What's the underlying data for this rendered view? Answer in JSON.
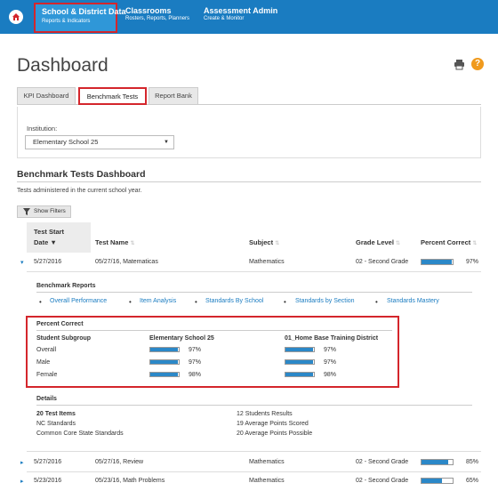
{
  "nav": {
    "active": {
      "title": "School & District Data",
      "sub": "Reports & Indicators"
    },
    "items": [
      {
        "title": "Classrooms",
        "sub": "Rosters, Reports, Planners"
      },
      {
        "title": "Assessment Admin",
        "sub": "Create & Monitor"
      }
    ]
  },
  "page": {
    "title": "Dashboard",
    "help": "?"
  },
  "tabs": [
    "KPI Dashboard",
    "Benchmark Tests",
    "Report Bank"
  ],
  "institution": {
    "label": "Institution:",
    "value": "Elementary School 25"
  },
  "section": {
    "title": "Benchmark Tests Dashboard",
    "subtitle": "Tests administered in the current school year.",
    "filter_label": "Show Filters"
  },
  "table": {
    "headers": {
      "date_line1": "Test Start",
      "date_line2": "Date",
      "name": "Test Name",
      "subject": "Subject",
      "grade": "Grade Level",
      "pct": "Percent Correct"
    },
    "rows": [
      {
        "date": "5/27/2016",
        "name": "05/27/16, Matematicas",
        "subject": "Mathematics",
        "grade": "02 - Second Grade",
        "pct": "97%",
        "fill": 0.97
      },
      {
        "date": "5/27/2016",
        "name": "05/27/16, Review",
        "subject": "Mathematics",
        "grade": "02 - Second Grade",
        "pct": "85%",
        "fill": 0.85
      },
      {
        "date": "5/23/2016",
        "name": "05/23/16, Math Problems",
        "subject": "Mathematics",
        "grade": "02 - Second Grade",
        "pct": "65%",
        "fill": 0.65
      }
    ]
  },
  "detail": {
    "reports_title": "Benchmark Reports",
    "links": [
      "Overall Performance",
      "Item Analysis",
      "Standards By School",
      "Standards by Section",
      "Standards Mastery"
    ],
    "pc_title": "Percent Correct",
    "pc_headers": [
      "Student Subgroup",
      "Elementary School 25",
      "01_Home Base Training District"
    ],
    "pc_rows": [
      {
        "label": "Overall",
        "school": "97%",
        "school_fill": 0.97,
        "district": "97%",
        "district_fill": 0.97
      },
      {
        "label": "Male",
        "school": "97%",
        "school_fill": 0.97,
        "district": "97%",
        "district_fill": 0.97
      },
      {
        "label": "Female",
        "school": "98%",
        "school_fill": 0.98,
        "district": "98%",
        "district_fill": 0.98
      }
    ],
    "details_title": "Details",
    "details_left": [
      "20 Test Items",
      "NC Standards",
      "Common Core State Standards"
    ],
    "details_right": [
      "12 Students Results",
      "19 Average Points Scored",
      "20 Average Points Possible"
    ]
  },
  "colors": {
    "nav_bg": "#1a7cc1",
    "accent": "#d4262c",
    "bar_fill": "#2b88c8",
    "help": "#f09a1d"
  }
}
